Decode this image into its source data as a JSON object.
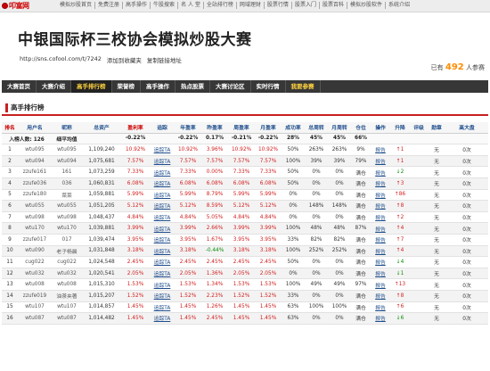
{
  "topbar": {
    "logo": "叩富网",
    "links": [
      "模拟炒股首页",
      "免费注册",
      "高手操作",
      "牛股搜索",
      "名 人 堂",
      "全站排行榜",
      "网域理财",
      "股票行情",
      "股票入门",
      "股票百科",
      "模拟炒股软件",
      "系统介绍"
    ]
  },
  "header": {
    "title": "中银国际杯三校协会模拟炒股大赛",
    "url": "http://sns.cofool.com/t/7242",
    "add_fav": "添加到收藏夹",
    "copy_link": "复制链接地址",
    "participants_prefix": "已有",
    "participants_count": "492",
    "participants_suffix": "人参赛"
  },
  "nav": {
    "items": [
      {
        "label": "大赛首页",
        "state": "normal"
      },
      {
        "label": "大赛介绍",
        "state": "normal"
      },
      {
        "label": "高手排行榜",
        "state": "active"
      },
      {
        "label": "荣誉榜",
        "state": "normal"
      },
      {
        "label": "高手操作",
        "state": "normal"
      },
      {
        "label": "热点股票",
        "state": "normal"
      },
      {
        "label": "大赛讨论区",
        "state": "normal"
      },
      {
        "label": "实时行情",
        "state": "normal"
      },
      {
        "label": "我要参赛",
        "state": "hi"
      }
    ]
  },
  "section": {
    "title": "高手排行榜"
  },
  "table": {
    "headers": [
      "排名",
      "用户名",
      "昵称",
      "总资产",
      "盈利率",
      "追踪",
      "年盈率",
      "昨盈率",
      "周盈率",
      "月盈率",
      "成功率",
      "总周转",
      "月周转",
      "仓位",
      "操作",
      "升降",
      "评级",
      "勋章",
      "高大盘"
    ],
    "avg_row": {
      "label": "入榜人数: 126",
      "nick": "细平均值",
      "profit": "-0.22%",
      "year": "-0.22%",
      "yest": "0.17%",
      "week": "-0.21%",
      "month": "-0.22%",
      "success": "28%",
      "turnover": "45%",
      "month_turnover": "45%",
      "position": "66%"
    },
    "rows": [
      [
        "1",
        "wtu095",
        "wtu095",
        "1,109,240",
        "10.92%",
        "追踪TA",
        "10.92%",
        "3.96%",
        "10.92%",
        "10.92%",
        "50%",
        "263%",
        "263%",
        "9%",
        "报告",
        "↑1",
        "",
        "无",
        "0次"
      ],
      [
        "2",
        "wtu094",
        "wtu094",
        "1,075,681",
        "7.57%",
        "追踪TA",
        "7.57%",
        "7.57%",
        "7.57%",
        "7.57%",
        "100%",
        "39%",
        "39%",
        "79%",
        "报告",
        "↑1",
        "",
        "无",
        "0次"
      ],
      [
        "3",
        "zzufe161",
        "161",
        "1,073,259",
        "7.33%",
        "追踪TA",
        "7.33%",
        "0.00%",
        "7.33%",
        "7.33%",
        "50%",
        "0%",
        "0%",
        "满仓",
        "报告",
        "↓2",
        "",
        "无",
        "0次"
      ],
      [
        "4",
        "zzufe036",
        "036",
        "1,060,831",
        "6.08%",
        "追踪TA",
        "6.08%",
        "6.08%",
        "6.08%",
        "6.08%",
        "50%",
        "0%",
        "0%",
        "满仓",
        "报告",
        "↑3",
        "",
        "无",
        "0次"
      ],
      [
        "5",
        "zzufe180",
        "菜菜",
        "1,059,881",
        "5.99%",
        "追踪TA",
        "5.99%",
        "8.79%",
        "5.99%",
        "5.99%",
        "0%",
        "0%",
        "0%",
        "满仓",
        "报告",
        "↑86",
        "",
        "无",
        "0次"
      ],
      [
        "6",
        "wtu055",
        "wtu055",
        "1,051,205",
        "5.12%",
        "追踪TA",
        "5.12%",
        "8.59%",
        "5.12%",
        "5.12%",
        "0%",
        "148%",
        "148%",
        "满仓",
        "报告",
        "↑8",
        "",
        "无",
        "0次"
      ],
      [
        "7",
        "wtu098",
        "wtu098",
        "1,048,437",
        "4.84%",
        "追踪TA",
        "4.84%",
        "5.05%",
        "4.84%",
        "4.84%",
        "0%",
        "0%",
        "0%",
        "满仓",
        "报告",
        "↑2",
        "",
        "无",
        "0次"
      ],
      [
        "8",
        "wtu170",
        "wtu170",
        "1,039,881",
        "3.99%",
        "追踪TA",
        "3.99%",
        "2.66%",
        "3.99%",
        "3.99%",
        "100%",
        "48%",
        "48%",
        "87%",
        "报告",
        "↑4",
        "",
        "无",
        "0次"
      ],
      [
        "9",
        "zzufe017",
        "017",
        "1,039,474",
        "3.95%",
        "追踪TA",
        "3.95%",
        "1.67%",
        "3.95%",
        "3.95%",
        "33%",
        "82%",
        "82%",
        "满仓",
        "报告",
        "↑7",
        "",
        "无",
        "0次"
      ],
      [
        "10",
        "wtu090",
        "老子杨晨",
        "1,031,848",
        "3.18%",
        "追踪TA",
        "3.18%",
        "-0.44%",
        "3.18%",
        "3.18%",
        "100%",
        "252%",
        "252%",
        "满仓",
        "报告",
        "↑4",
        "",
        "无",
        "0次"
      ],
      [
        "11",
        "cug022",
        "cug022",
        "1,024,548",
        "2.45%",
        "追踪TA",
        "2.45%",
        "2.45%",
        "2.45%",
        "2.45%",
        "50%",
        "0%",
        "0%",
        "满仓",
        "报告",
        "↓4",
        "",
        "无",
        "0次"
      ],
      [
        "12",
        "wtu032",
        "wtu032",
        "1,020,541",
        "2.05%",
        "追踪TA",
        "2.05%",
        "1.36%",
        "2.05%",
        "2.05%",
        "0%",
        "0%",
        "0%",
        "满仓",
        "报告",
        "↓1",
        "",
        "无",
        "0次"
      ],
      [
        "13",
        "wtu008",
        "wtu008",
        "1,015,310",
        "1.53%",
        "追踪TA",
        "1.53%",
        "1.34%",
        "1.53%",
        "1.53%",
        "100%",
        "49%",
        "49%",
        "97%",
        "报告",
        "↑13",
        "",
        "无",
        "0次"
      ],
      [
        "14",
        "zzufe019",
        "油茶夹著",
        "1,015,207",
        "1.52%",
        "追踪TA",
        "1.52%",
        "2.23%",
        "1.52%",
        "1.52%",
        "33%",
        "0%",
        "0%",
        "满仓",
        "报告",
        "↑8",
        "",
        "无",
        "0次"
      ],
      [
        "15",
        "wtu107",
        "wtu107",
        "1,014,857",
        "1.45%",
        "追踪TA",
        "1.45%",
        "1.26%",
        "1.45%",
        "1.45%",
        "63%",
        "100%",
        "100%",
        "满仓",
        "报告",
        "↑6",
        "",
        "无",
        "0次"
      ],
      [
        "16",
        "wtu087",
        "wtu087",
        "1,014,482",
        "1.45%",
        "追踪TA",
        "1.45%",
        "2.45%",
        "1.45%",
        "1.45%",
        "63%",
        "0%",
        "0%",
        "满仓",
        "报告",
        "↓6",
        "",
        "无",
        "0次"
      ]
    ]
  }
}
